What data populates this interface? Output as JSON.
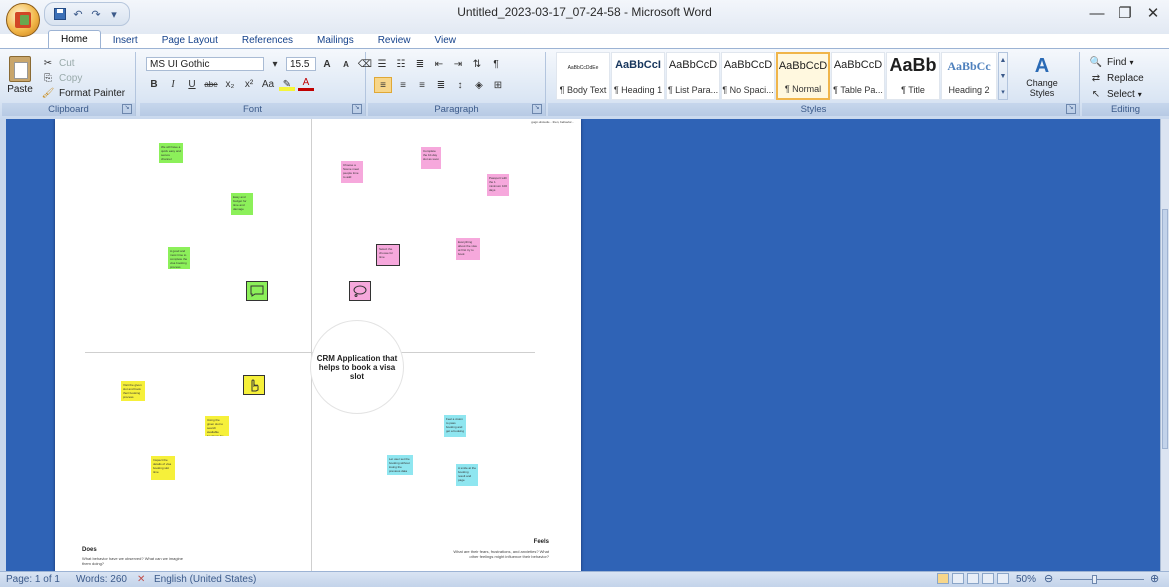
{
  "window": {
    "title": "Untitled_2023-03-17_07-24-58 - Microsoft Word",
    "minimize": "—",
    "restore": "❐",
    "close": "✕"
  },
  "tabs": [
    "Home",
    "Insert",
    "Page Layout",
    "References",
    "Mailings",
    "Review",
    "View"
  ],
  "clipboard": {
    "paste": "Paste",
    "cut": "Cut",
    "copy": "Copy",
    "format_painter": "Format Painter",
    "label": "Clipboard"
  },
  "font": {
    "family": "MS UI Gothic",
    "size": "15.5",
    "label": "Font",
    "grow": "A",
    "shrink": "A",
    "bold": "B",
    "italic": "I",
    "underline": "U",
    "strike": "abe",
    "subscript": "x₂",
    "superscript": "x²",
    "change_case": "Aa",
    "font_color": "A"
  },
  "paragraph": {
    "label": "Paragraph"
  },
  "styles": {
    "label": "Styles",
    "items": [
      {
        "sample": "AaBbCcDdEe",
        "name": "¶ Body Text"
      },
      {
        "sample": "AaBbCcI",
        "name": "¶ Heading 1"
      },
      {
        "sample": "AaBbCcD",
        "name": "¶ List Para..."
      },
      {
        "sample": "AaBbCcD",
        "name": "¶ No Spaci..."
      },
      {
        "sample": "AaBbCcD",
        "name": "¶ Normal"
      },
      {
        "sample": "AaBbCcD",
        "name": "¶ Table Pa..."
      },
      {
        "sample": "AaBb",
        "name": "¶ Title"
      },
      {
        "sample": "AaBbCc",
        "name": "Heading 2"
      }
    ],
    "change_styles": "Change Styles"
  },
  "editing": {
    "label": "Editing",
    "find": "Find",
    "replace": "Replace",
    "select": "Select"
  },
  "document": {
    "center_text": "CRM Application  that helps to book a visa slot",
    "top_right_caption": "gugn.ulncedu... then, behavior...",
    "does_title": "Does",
    "does_text": "What behavior have we observed? What can we imagine them doing?",
    "feels_title": "Feels",
    "feels_text": "What are their fears, frustrations, and anxieties? What other feelings might influence their behavior?",
    "notes": {
      "green": [
        "We will have a quick easy and secure channel",
        "Easy and budget for time and damage",
        "A good and most time to complete the visa booking process"
      ],
      "pink": [
        "Choose a Scene meet people time to add",
        "Complete the 10-day slot as soon",
        "Passport with the 1 minimum 100 days",
        "Select the choose for time",
        "Everything about the visa at first try to book"
      ],
      "yellow": [
        "Visit the given slot and book their booking process",
        "Using the given slot to search available bookings for agents",
        "Inspect the details of visa booking slot time"
      ],
      "blue": [
        "Feel a vision to pass booking and get a booking",
        "Let user set the booking without losing the previous data",
        "A smile at the booking result and page"
      ]
    }
  },
  "statusbar": {
    "page": "Page: 1 of 1",
    "words": "Words: 260",
    "language": "English (United States)",
    "zoom": "50%"
  },
  "colors": {
    "accent": "#2f63b6",
    "sticky_green": "#8cf05a",
    "sticky_pink": "#f6a8dc",
    "sticky_yellow": "#f6f03a",
    "sticky_blue": "#8fe6f0"
  }
}
